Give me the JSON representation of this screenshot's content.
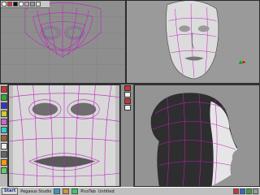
{
  "colors": {
    "wire": "#c020c0",
    "wire_light": "#e040e0",
    "mesh_white": "#f4f4f4",
    "viewport_bg": "#8d8d8d",
    "start_blue": "#102a8a"
  },
  "viewports": [
    {
      "id": "front",
      "label": ""
    },
    {
      "id": "perspective",
      "label": ""
    },
    {
      "id": "face-closeup",
      "label": ""
    },
    {
      "id": "side",
      "label": ""
    }
  ],
  "toolbar_icons": [
    "select-icon",
    "move-icon",
    "rotate-icon",
    "scale-icon",
    "render-icon",
    "camera-icon",
    "light-icon"
  ],
  "left_tools": [
    "tool-1",
    "tool-2",
    "tool-3",
    "tool-4",
    "tool-5",
    "tool-6",
    "tool-7",
    "tool-8",
    "tool-9",
    "tool-10",
    "tool-11"
  ],
  "mid_tools": [
    "view-front-icon",
    "view-side-icon",
    "view-top-icon",
    "view-persp-icon"
  ],
  "statusbar": {
    "start_label": "Start",
    "item_1": "Pegasus Studio",
    "item_2": "PicoTab",
    "item_3": "Untitled"
  }
}
